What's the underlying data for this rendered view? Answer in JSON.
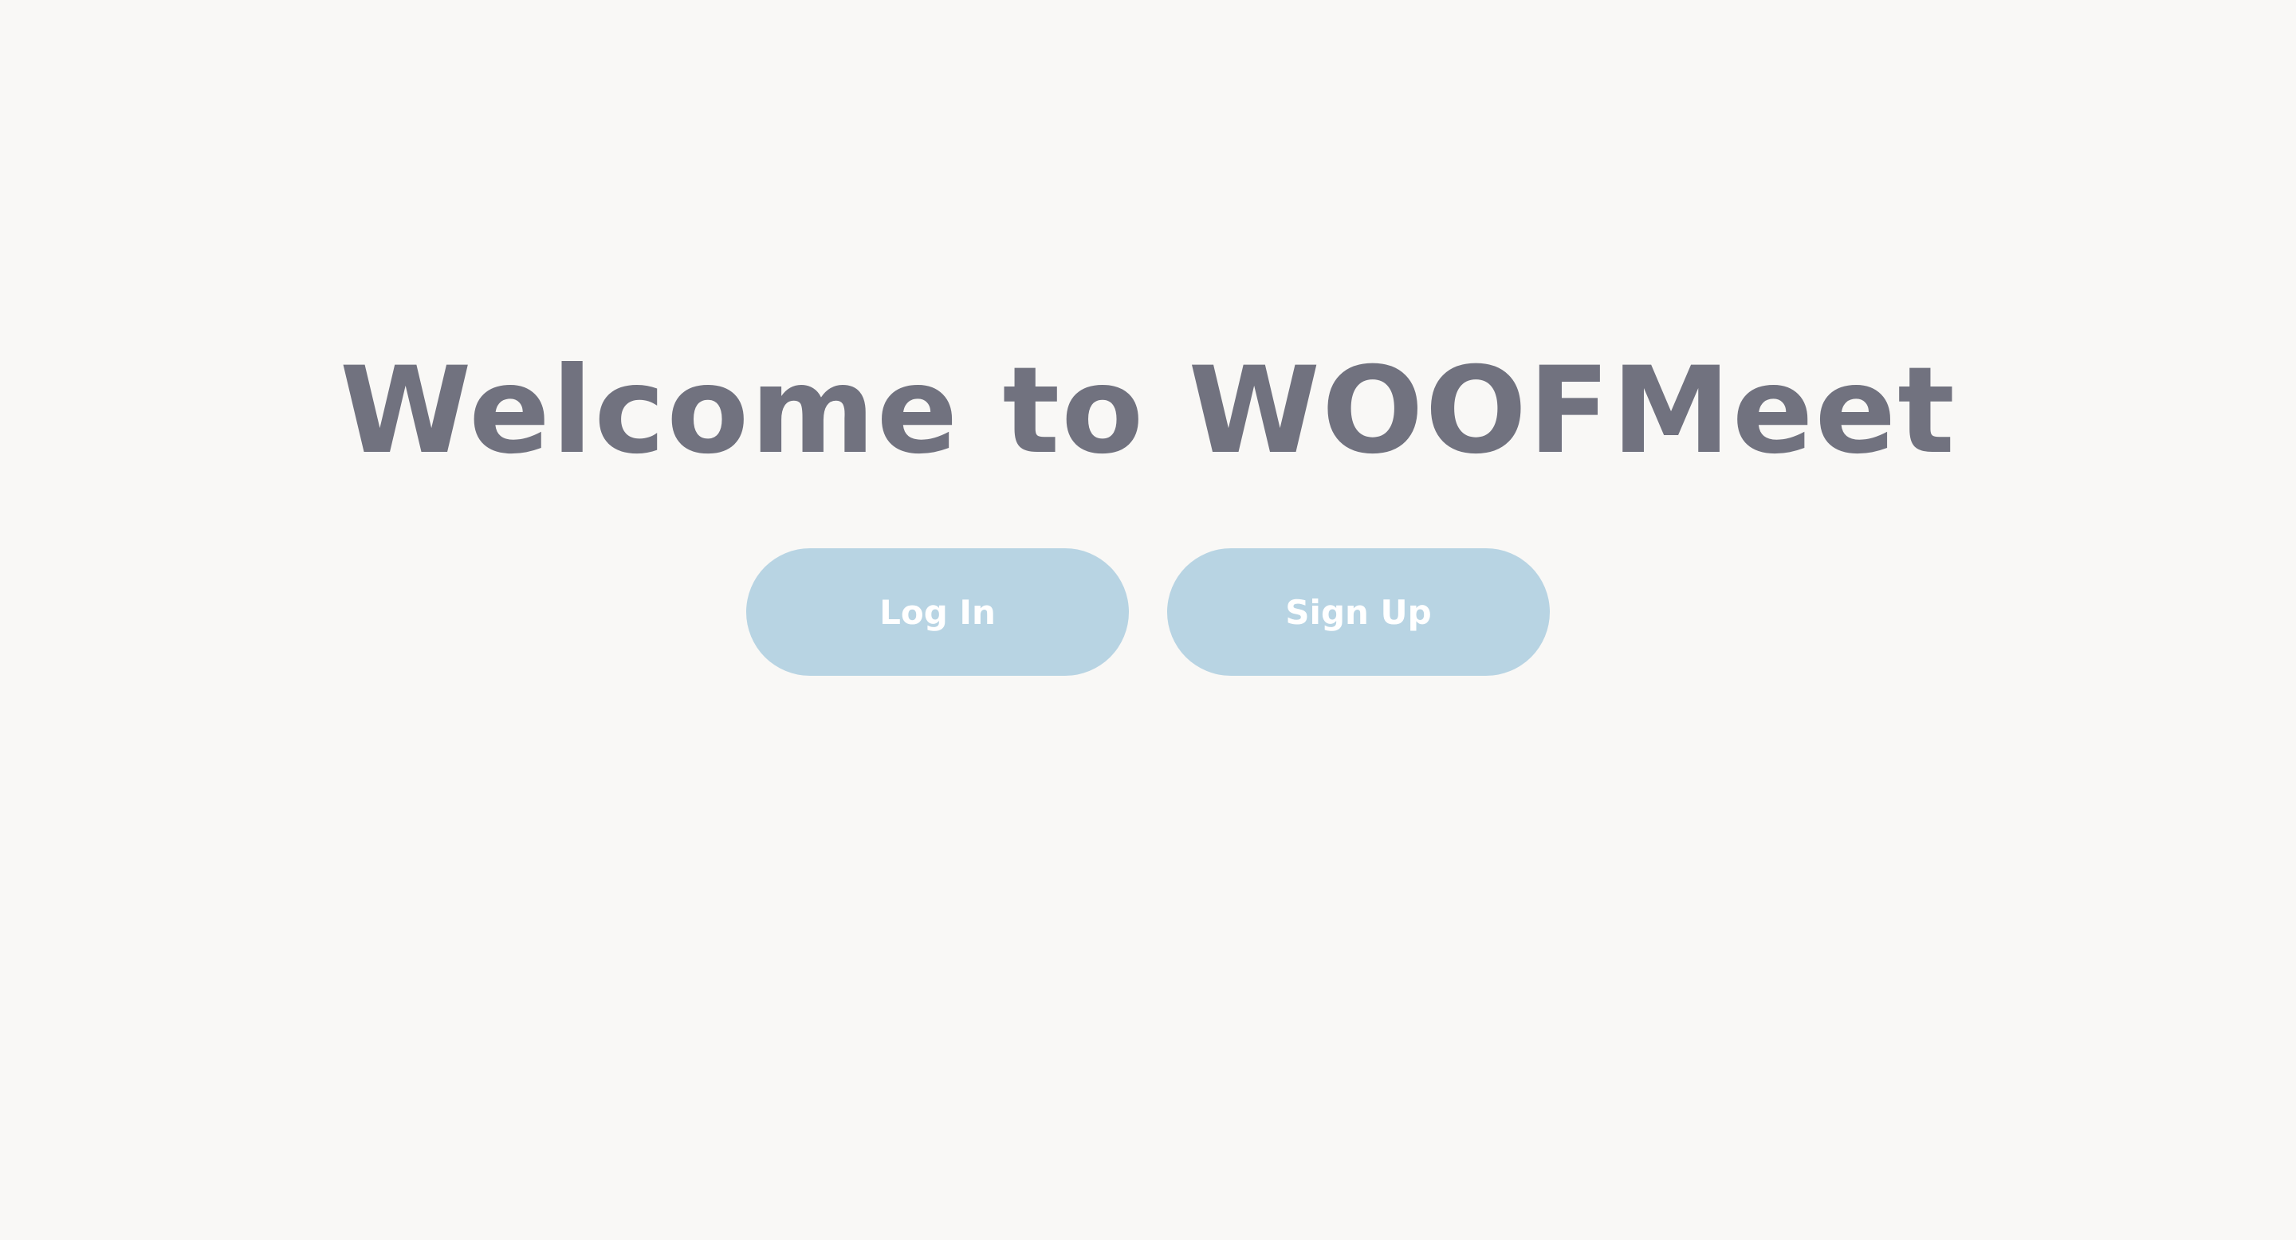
{
  "page": {
    "title_prefix": "Welcome to ",
    "brand_part1": "WOOF",
    "brand_part2": "Meet"
  },
  "actions": {
    "login_label": "Log In",
    "signup_label": "Sign Up"
  },
  "colors": {
    "background": "#f9f8f6",
    "title_text": "#71727f",
    "button_bg": "#b8d4e3",
    "button_text": "#ffffff"
  }
}
